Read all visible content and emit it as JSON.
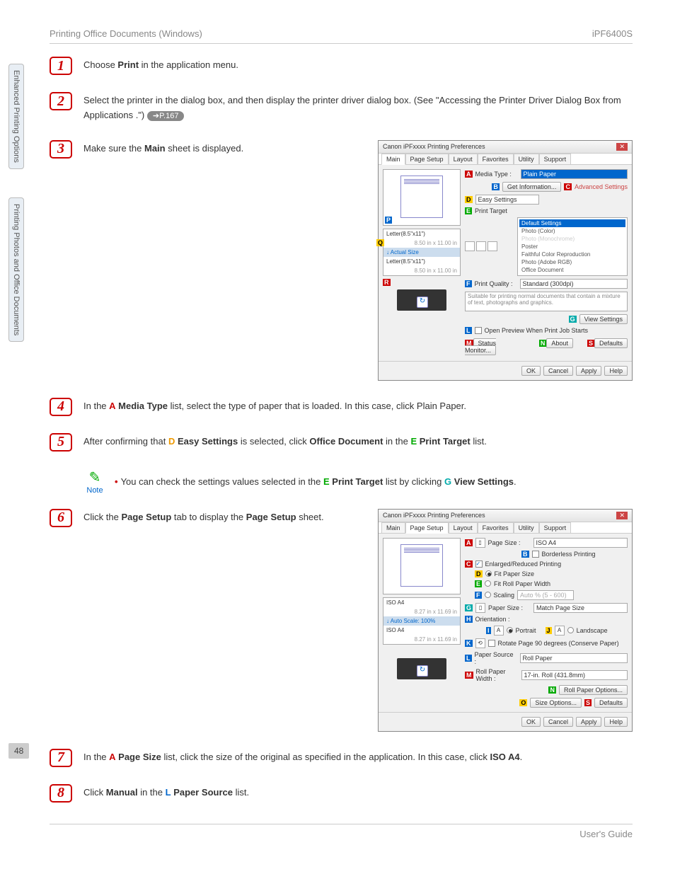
{
  "header": {
    "left": "Printing Office Documents (Windows)",
    "right": "iPF6400S"
  },
  "sidebar": {
    "tab1": "Enhanced Printing Options",
    "tab2": "Printing Photos and Office Documents",
    "page": "48"
  },
  "steps": {
    "s1": {
      "num": "1",
      "t1": "Choose ",
      "b1": "Print",
      "t2": " in the application menu."
    },
    "s2": {
      "num": "2",
      "t1": "Select the printer in the dialog box, and then display the printer driver dialog box.  (See \"Accessing the Printer Driver Dialog Box from Applications .\") ",
      "link": "➔P.167"
    },
    "s3": {
      "num": "3",
      "t1": "Make sure the ",
      "b1": "Main",
      "t2": " sheet is displayed."
    },
    "s4": {
      "num": "4",
      "t1": "In the ",
      "letA": "A",
      "b1": "Media Type",
      "t2": " list, select the type of paper that is loaded. In this case, click Plain Paper."
    },
    "s5": {
      "num": "5",
      "t1": "After confirming that ",
      "letD": "D",
      "b1": "Easy Settings",
      "t2": " is selected, click ",
      "b2": "Office Document",
      "t3": " in the ",
      "letE": "E",
      "b3": "Print Target",
      "t4": " list."
    },
    "note": {
      "label": "Note",
      "t1": "You can check the settings values selected in the ",
      "letE": "E",
      "b1": "Print Target",
      "t2": " list by clicking ",
      "letG": "G",
      "b2": "View Settings",
      "t3": "."
    },
    "s6": {
      "num": "6",
      "t1": "Click the ",
      "b1": "Page Setup",
      "t2": " tab to display the ",
      "b2": "Page Setup",
      "t3": " sheet."
    },
    "s7": {
      "num": "7",
      "t1": "In the ",
      "letA": "A",
      "b1": "Page Size",
      "t2": " list, click the size of the original as specified in the application. In this case, click ",
      "b2": "ISO A4",
      "t3": "."
    },
    "s8": {
      "num": "8",
      "t1": "Click ",
      "b1": "Manual",
      "t2": " in the ",
      "letL": "L",
      "b2": "Paper Source",
      "t3": " list."
    }
  },
  "dlg1": {
    "title": "Canon iPFxxxx Printing Preferences",
    "tabs": [
      "Main",
      "Page Setup",
      "Layout",
      "Favorites",
      "Utility",
      "Support"
    ],
    "mediaTypeLbl": "Media Type :",
    "mediaType": "Plain Paper",
    "getInfo": "Get Information...",
    "advanced": "Advanced Settings",
    "easySettings": "Easy Settings",
    "printTargetLbl": "Print Target",
    "targets": [
      "Default Settings",
      "Photo (Color)",
      "Photo (Monochrome)",
      "Poster",
      "Faithful Color Reproduction",
      "Photo (Adobe RGB)",
      "Office Document"
    ],
    "qualityLbl": "Print Quality :",
    "quality": "Standard (300dpi)",
    "desc": "Suitable for printing normal documents that contain a mixture of text, photographs and graphics.",
    "viewSettings": "View Settings",
    "openPreview": "Open Preview When Print Job Starts",
    "statusMonitor": "Status Monitor...",
    "about": "About",
    "defaults": "Defaults",
    "sizeLine1": "Letter(8.5\"x11\")",
    "sizeDim1": "8.50 in x 11.00 in",
    "actualSize": "↓  Actual Size",
    "sizeLine2": "Letter(8.5\"x11\")",
    "sizeDim2": "8.50 in x 11.00 in",
    "ok": "OK",
    "cancel": "Cancel",
    "apply": "Apply",
    "help": "Help"
  },
  "dlg2": {
    "title": "Canon iPFxxxx Printing Preferences",
    "tabs": [
      "Main",
      "Page Setup",
      "Layout",
      "Favorites",
      "Utility",
      "Support"
    ],
    "pageSizeLbl": "Page Size :",
    "pageSize": "ISO A4",
    "borderless": "Borderless Printing",
    "enlarged": "Enlarged/Reduced Printing",
    "fitPaper": "Fit Paper Size",
    "fitRoll": "Fit Roll Paper Width",
    "scaling": "Scaling",
    "scalingVal": "Auto    %  (5 - 600)",
    "paperSizeLbl": "Paper Size :",
    "paperSize": "Match Page Size",
    "orientLbl": "Orientation :",
    "portrait": "Portrait",
    "landscape": "Landscape",
    "rotate": "Rotate Page 90 degrees (Conserve Paper)",
    "paperSourceLbl": "Paper Source :",
    "paperSource": "Roll Paper",
    "rollWidthLbl": "Roll Paper Width :",
    "rollWidth": "17-in. Roll (431.8mm)",
    "rollOptions": "Roll Paper Options...",
    "sizeOptions": "Size Options...",
    "defaults": "Defaults",
    "sizeLine1": "ISO A4",
    "sizeDim1": "8.27 in x 11.69 in",
    "autoScale": "↓  Auto Scale: 100%",
    "sizeLine2": "ISO A4",
    "sizeDim2": "8.27 in x 11.69 in",
    "ok": "OK",
    "cancel": "Cancel",
    "apply": "Apply",
    "help": "Help"
  },
  "footer": "User's Guide"
}
